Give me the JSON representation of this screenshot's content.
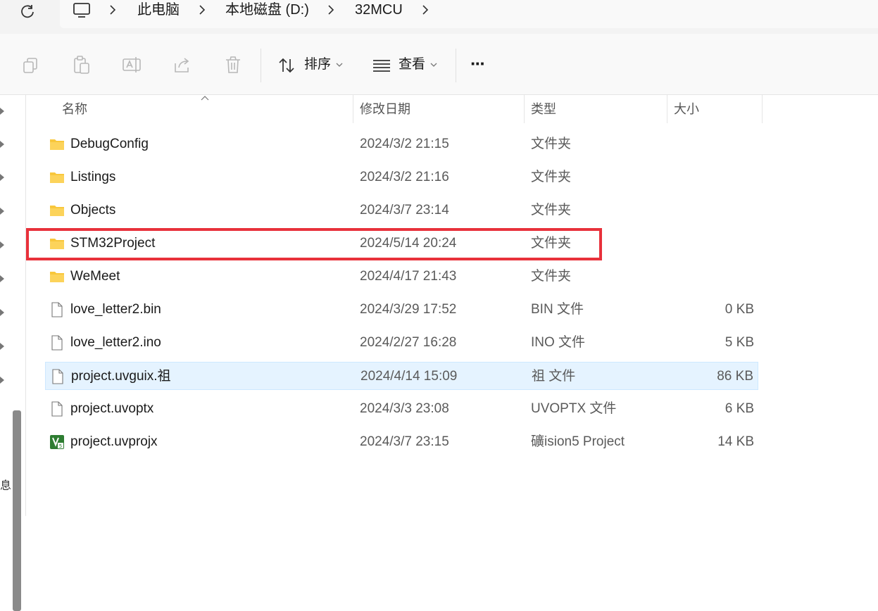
{
  "breadcrumb": [
    "此电脑",
    "本地磁盘 (D:)",
    "32MCU"
  ],
  "toolbar": {
    "sort_label": "排序",
    "view_label": "查看",
    "more_label": "···"
  },
  "columns": {
    "name": "名称",
    "date": "修改日期",
    "type": "类型",
    "size": "大小"
  },
  "files": [
    {
      "name": "DebugConfig",
      "date": "2024/3/2 21:15",
      "type": "文件夹",
      "size": "",
      "icon": "folder-icon"
    },
    {
      "name": "Listings",
      "date": "2024/3/2 21:16",
      "type": "文件夹",
      "size": "",
      "icon": "folder-icon"
    },
    {
      "name": "Objects",
      "date": "2024/3/7 23:14",
      "type": "文件夹",
      "size": "",
      "icon": "folder-icon"
    },
    {
      "name": "STM32Project",
      "date": "2024/5/14 20:24",
      "type": "文件夹",
      "size": "",
      "icon": "folder-icon"
    },
    {
      "name": "WeMeet",
      "date": "2024/4/17 21:43",
      "type": "文件夹",
      "size": "",
      "icon": "folder-icon"
    },
    {
      "name": "love_letter2.bin",
      "date": "2024/3/29 17:52",
      "type": "BIN 文件",
      "size": "0 KB",
      "icon": "file-icon"
    },
    {
      "name": "love_letter2.ino",
      "date": "2024/2/27 16:28",
      "type": "INO 文件",
      "size": "5 KB",
      "icon": "file-icon"
    },
    {
      "name": "project.uvguix.祖",
      "date": "2024/4/14 15:09",
      "type": "祖 文件",
      "size": "86 KB",
      "icon": "file-icon"
    },
    {
      "name": "project.uvoptx",
      "date": "2024/3/3 23:08",
      "type": "UVOPTX 文件",
      "size": "6 KB",
      "icon": "file-icon"
    },
    {
      "name": "project.uvprojx",
      "date": "2024/3/7 23:15",
      "type": "礦ision5 Project",
      "size": "14 KB",
      "icon": "uvision-icon"
    }
  ],
  "selected_row": "project.uvguix.祖",
  "highlighted_row": "STM32Project",
  "nav_side_char": "息",
  "colors": {
    "selection_bg": "#e5f3ff",
    "highlight_border": "#e8313b",
    "folder": "#f8c73c"
  }
}
